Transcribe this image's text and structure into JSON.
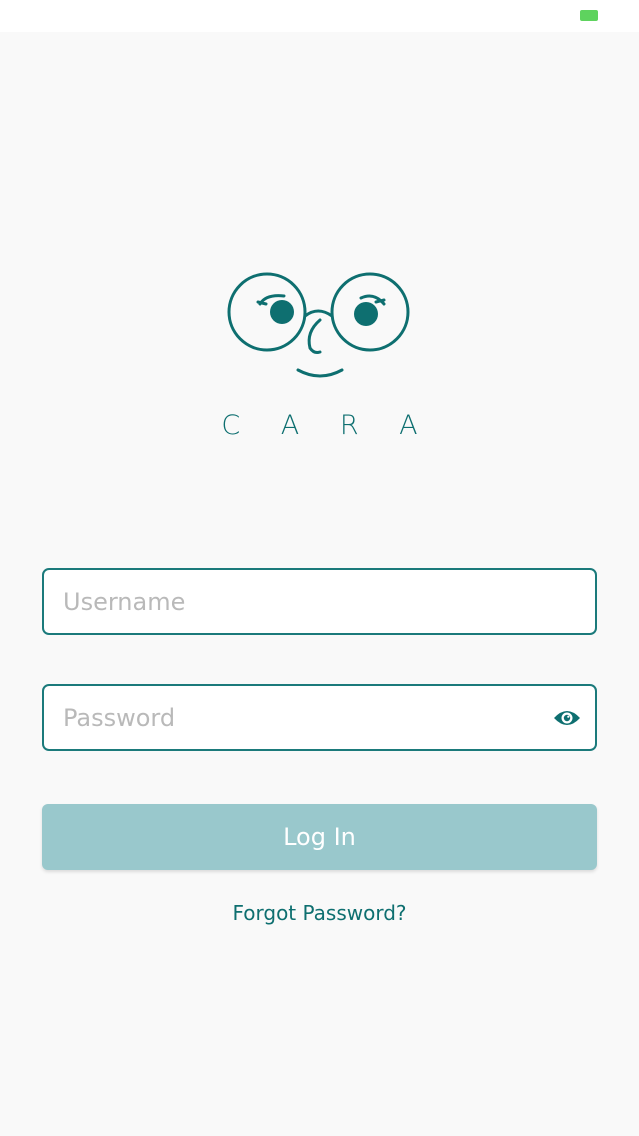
{
  "brand": {
    "name": "C A R A",
    "primary_color": "#0e6f70",
    "logo_icon": "face-with-glasses-icon"
  },
  "status_bar": {
    "battery_icon": "battery-icon",
    "battery_color": "#5ed35e"
  },
  "form": {
    "username": {
      "value": "",
      "placeholder": "Username"
    },
    "password": {
      "value": "",
      "placeholder": "Password",
      "toggle_icon": "eye-icon"
    },
    "login_label": "Log In",
    "login_color": "#99c8cc",
    "forgot_label": "Forgot Password?"
  }
}
